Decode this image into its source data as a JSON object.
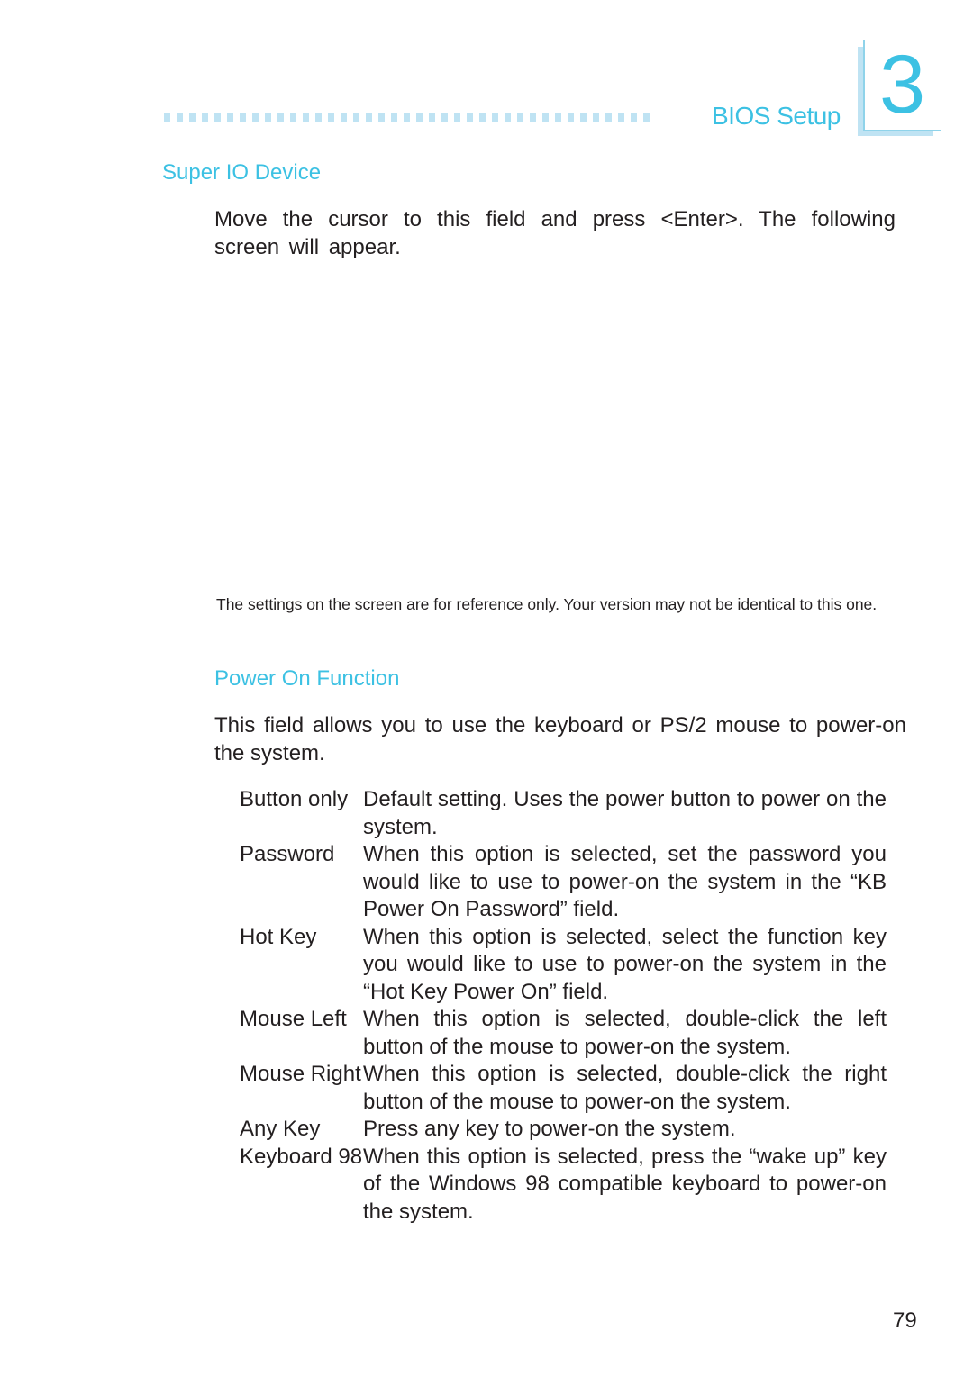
{
  "header": {
    "chapter_title": "BIOS Setup",
    "chapter_number": "3",
    "dot_count": 39,
    "accent_color": "#3cc1e3",
    "accent_light_color": "#bfe3f3"
  },
  "super_io": {
    "heading": "Super IO Device",
    "body": "Move the cursor to this field and press <Enter>. The following screen will appear."
  },
  "note": {
    "text": "The settings on the screen are for reference only. Your version may not be identical to this one."
  },
  "power_on": {
    "heading": "Power On Function",
    "body": "This field allows you to use the keyboard or PS/2 mouse to power-on the system.",
    "options": [
      {
        "label": "Button only",
        "description": "Default setting. Uses the power button to power on the system."
      },
      {
        "label": "Password",
        "description": "When this option is selected, set the password you would like to use to power-on the system in the “KB Power On Password” field."
      },
      {
        "label": "Hot Key",
        "description": "When this option is selected, select the function key you would like to use to power-on the system in the “Hot Key Power On” field."
      },
      {
        "label": "Mouse Left",
        "description": "When this option is selected, double-click the left button of the mouse to power-on the system."
      },
      {
        "label": "Mouse Right",
        "description": "When this option is selected, double-click the right button of the mouse to power-on the system."
      },
      {
        "label": "Any Key",
        "description": "Press any key to power-on the system."
      },
      {
        "label": "Keyboard 98",
        "description": "When this option is selected, press the “wake up” key of the Windows 98 compatible keyboard to power-on the system."
      }
    ]
  },
  "footer": {
    "page_number": "79"
  }
}
